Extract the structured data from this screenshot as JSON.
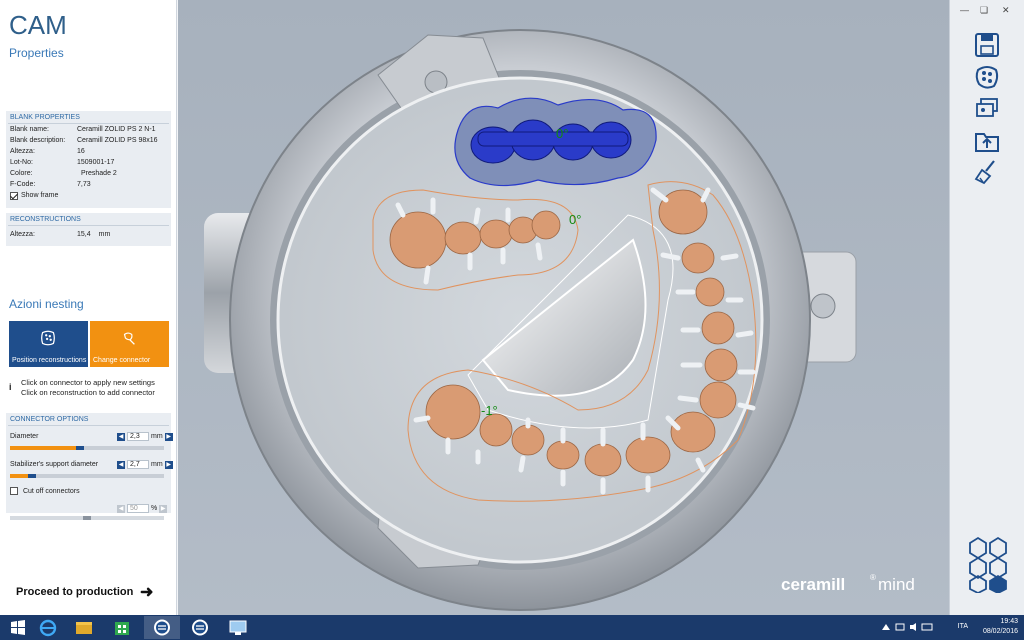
{
  "app": {
    "title": "CAM",
    "subtitle": "Properties"
  },
  "blank_properties": {
    "title": "BLANK PROPERTIES",
    "rows": [
      {
        "key": "Blank name:",
        "value": "Ceramill ZOLID PS 2 N-1"
      },
      {
        "key": "Blank description:",
        "value": "Ceramill ZOLID PS 98x16"
      },
      {
        "key": "Altezza:",
        "value": "16"
      },
      {
        "key": "Lot-No:",
        "value": "1509001-17"
      },
      {
        "key": "Colore:",
        "value": "Preshade 2"
      },
      {
        "key": "F-Code:",
        "value": "7,73"
      }
    ],
    "show_frame_label": "Show frame",
    "show_frame_checked": true
  },
  "reconstructions": {
    "title": "RECONSTRUCTIONS",
    "altezza_key": "Altezza:",
    "altezza_value": "15,4",
    "altezza_unit": "mm"
  },
  "nesting": {
    "title": "Azioni nesting",
    "position_label": "Position reconstructions",
    "change_label": "Change connector",
    "info_line1": "Click on connector to apply new settings",
    "info_line2": "Click on reconstruction to add connector"
  },
  "connector_options": {
    "title": "CONNECTOR OPTIONS",
    "diameter_label": "Diameter",
    "diameter_value": "2,3",
    "diameter_unit": "mm",
    "diameter_fraction": 0.45,
    "stabilizer_label": "Stabilizer's support diameter",
    "stabilizer_value": "2,7",
    "stabilizer_unit": "mm",
    "stabilizer_fraction": 0.12,
    "cut_off_label": "Cut off connectors",
    "cut_off_checked": false,
    "cut_off_value": "50",
    "cut_off_unit": "%",
    "cut_off_fraction": 0.5
  },
  "proceed_label": "Proceed to production",
  "viewport": {
    "angle_top": "0°",
    "angle_left": "0°",
    "angle_bottom": "-1°",
    "brand_text": "ceramill",
    "brand_mark": "®",
    "brand_suffix": "mind"
  },
  "taskbar": {
    "language": "ITA",
    "time": "19:43",
    "date": "08/02/2016"
  },
  "colors": {
    "accent_blue": "#1f4e8c",
    "accent_orange": "#f29111",
    "tooth": "#d99b73",
    "selected_blue": "#2a3bc9"
  }
}
